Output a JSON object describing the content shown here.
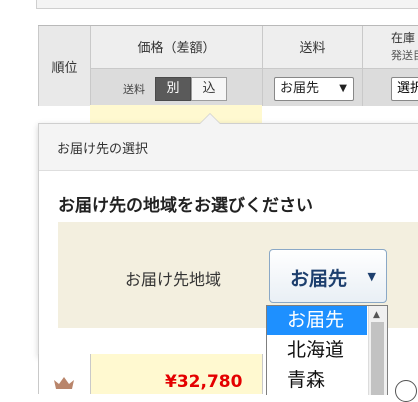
{
  "table": {
    "rank_header": "順位",
    "price_header": "価格（差額）",
    "ship_header": "送料",
    "stock_header_line1": "在庫",
    "stock_header_line2": "発送目",
    "shipping_label": "送料",
    "tax_excluded_label": "別",
    "tax_included_label": "込",
    "destination_select_value": "お届先",
    "stock_button_label": "選択"
  },
  "popup": {
    "header": "お届け先の選択",
    "title": "お届け先の地域をお選びください",
    "region_label": "お届け先地域",
    "region_select_value": "お届先"
  },
  "dropdown": {
    "options": [
      "お届先",
      "北海道",
      "青森"
    ],
    "selected_index": 0
  },
  "product_row": {
    "price": "¥32,780",
    "rank_icon": "crown-icon"
  },
  "colors": {
    "selection_blue": "#1e90ff",
    "price_red": "#e40000",
    "highlight_yellow": "#fff9d0",
    "region_box_beige": "#f3efdf",
    "select_text_navy": "#1d3f6e"
  }
}
